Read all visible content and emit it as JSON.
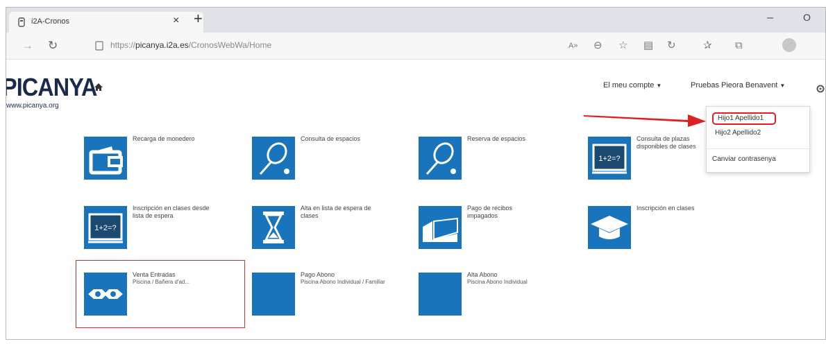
{
  "browser": {
    "tab_title": "i2A-Cronos",
    "tab_close": "×",
    "new_tab": "+",
    "minimize": "–",
    "maximize": "O",
    "url_prefix": "https://",
    "url_domain": "picanya.i2a.es",
    "url_path": "/CronosWebWa/Home",
    "toolbar_icons": [
      "read-aloud-icon",
      "zoom-icon",
      "favorites-add-icon",
      "collections-icon",
      "refresh-alt-icon",
      "favorites-icon",
      "share-icon",
      "profile-icon"
    ]
  },
  "header": {
    "logo_text": "PICANYA",
    "logo_subtext": "www.picanya.org",
    "account_menu": "El meu compte",
    "user_menu": "Pruebas Pieora Benavent"
  },
  "dropdown": {
    "items": [
      "Hijo1 Apellido1",
      "Hijo2 Apellido2"
    ],
    "change_password": "Canviar contrasenya"
  },
  "tiles": [
    {
      "title": "Recarga de monedero",
      "subtitle": "",
      "icon": "wallet-icon"
    },
    {
      "title": "Consulta de espacios",
      "subtitle": "",
      "icon": "tennis-racket-icon"
    },
    {
      "title": "Reserva de espacios",
      "subtitle": "",
      "icon": "tennis-racket-icon"
    },
    {
      "title": "Consulta de plazas disponibles de clases",
      "subtitle": "",
      "icon": "blackboard-icon"
    },
    {
      "title": "Inscripción en clases desde lista de espera",
      "subtitle": "",
      "icon": "blackboard-icon"
    },
    {
      "title": "Alta en lista de espera de clases",
      "subtitle": "",
      "icon": "hourglass-icon"
    },
    {
      "title": "Pago de recibos impagados",
      "subtitle": "",
      "icon": "receipt-icon"
    },
    {
      "title": "Inscripción en clases",
      "subtitle": "",
      "icon": "graduation-cap-icon"
    },
    {
      "title": "Venta Entradas",
      "subtitle": "Piscina / Bañera d'ad...",
      "icon": "tickets-icon"
    },
    {
      "title": "Pago Abono",
      "subtitle": "Piscina Abono Individual / Familiar",
      "icon": "blank-icon"
    },
    {
      "title": "Alta Abono",
      "subtitle": "Piscina Abono Individual",
      "icon": "blank-icon"
    }
  ],
  "colors": {
    "accent": "#1a74bb",
    "highlight": "#e02020",
    "logo": "#1a2a4a"
  }
}
